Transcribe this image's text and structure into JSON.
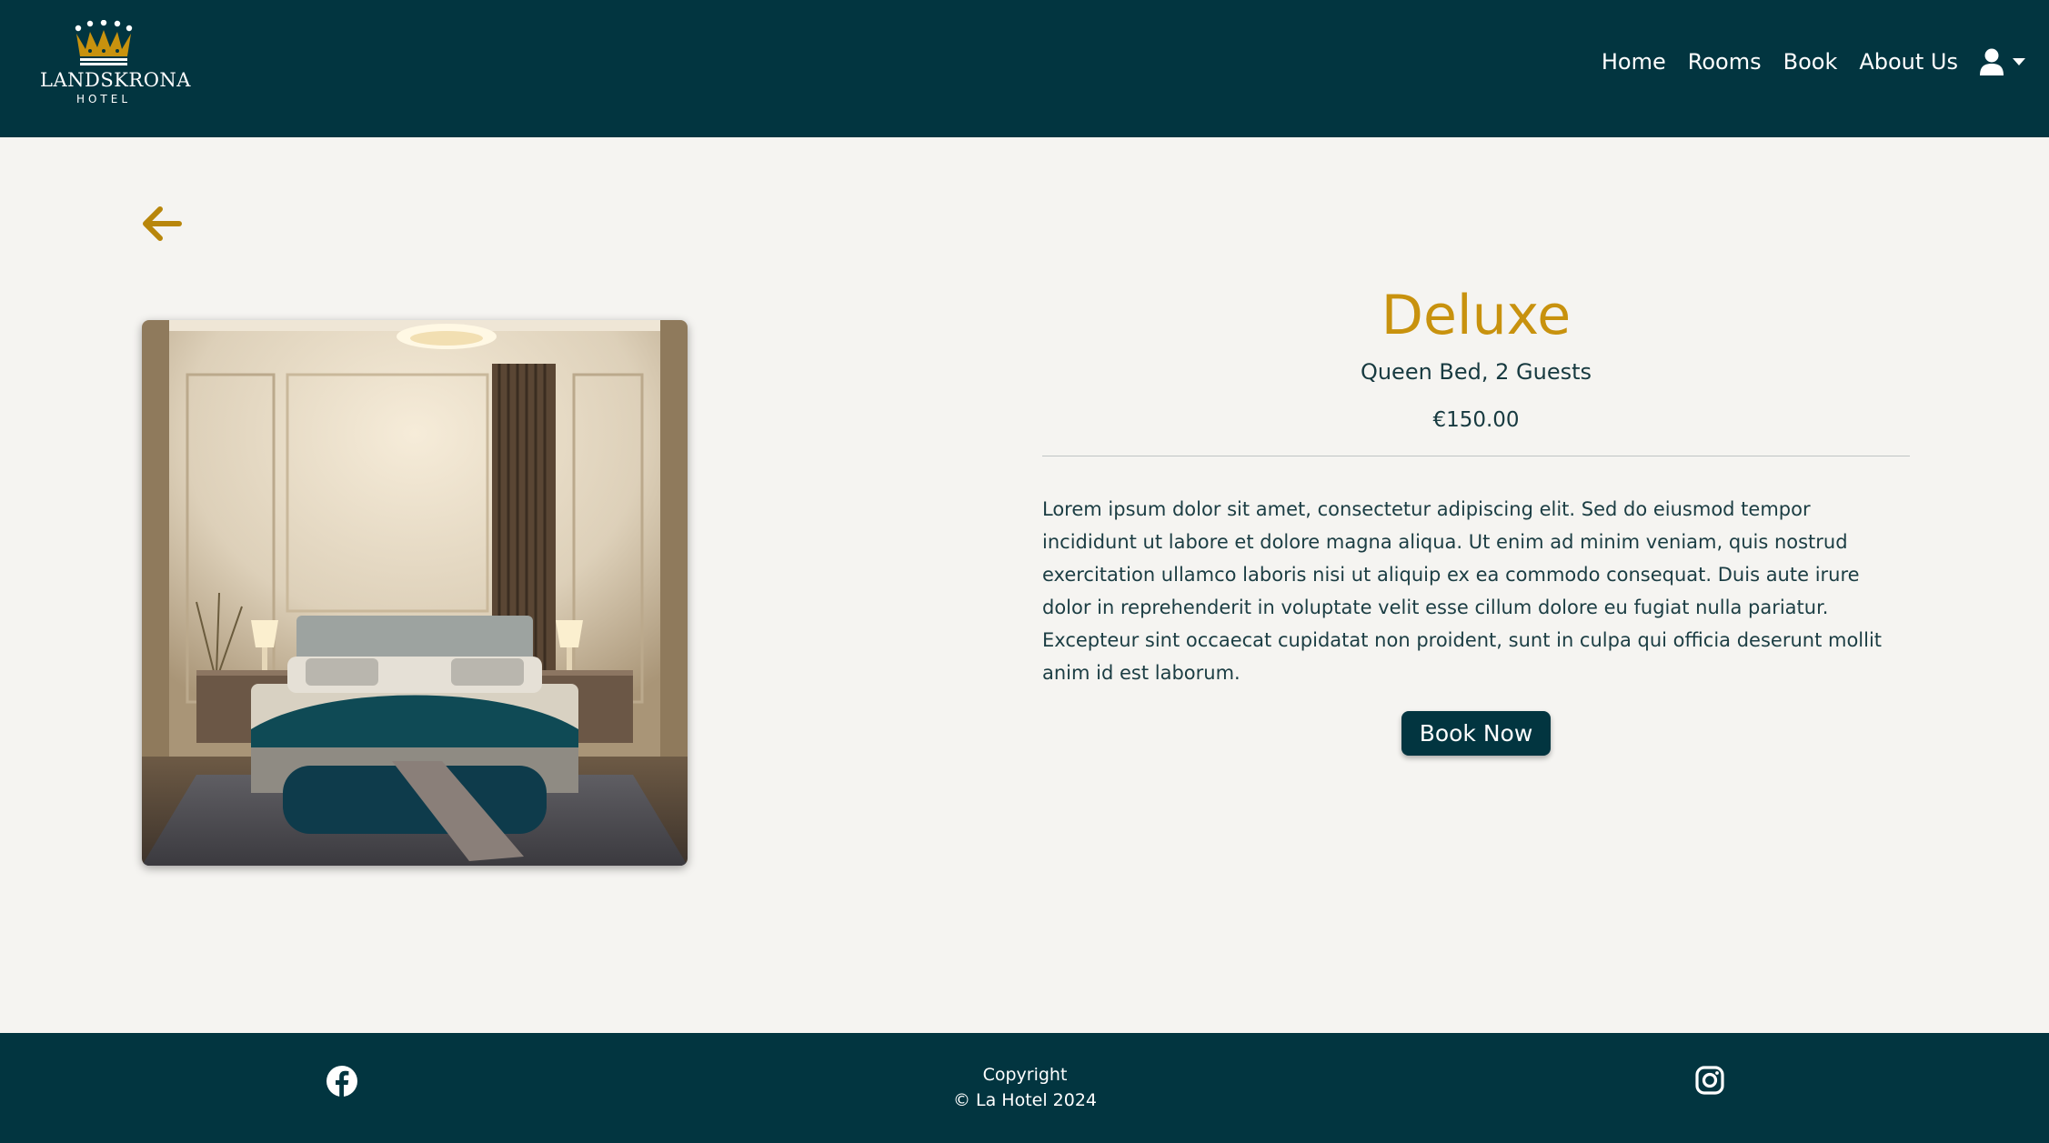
{
  "brand": {
    "name": "LANDSKRONA",
    "subtitle": "HOTEL"
  },
  "nav": {
    "items": [
      {
        "label": "Home"
      },
      {
        "label": "Rooms"
      },
      {
        "label": "Book"
      },
      {
        "label": "About Us"
      }
    ],
    "user_icon": "user-icon",
    "dropdown_icon": "caret-down-icon"
  },
  "back_icon": "arrow-left-icon",
  "room": {
    "title": "Deluxe",
    "subtitle": "Queen Bed, 2 Guests",
    "price": "€150.00",
    "description": "Lorem ipsum dolor sit amet, consectetur adipiscing elit. Sed do eiusmod tempor incididunt ut labore et dolore magna aliqua. Ut enim ad minim veniam, quis nostrud exercitation ullamco laboris nisi ut aliquip ex ea commodo consequat. Duis aute irure dolor in reprehenderit in voluptate velit esse cillum dolore eu fugiat nulla pariatur. Excepteur sint occaecat cupidatat non proident, sunt in culpa qui officia deserunt mollit anim id est laborum.",
    "book_label": "Book Now",
    "image": "room-photo"
  },
  "footer": {
    "copyright_line1": "Copyright",
    "copyright_line2": "© La Hotel 2024",
    "social": [
      "facebook-icon",
      "instagram-icon"
    ]
  },
  "colors": {
    "primary": "#023540",
    "accent": "#c8920e",
    "background": "#f5f4f1",
    "text": "#173a40"
  }
}
